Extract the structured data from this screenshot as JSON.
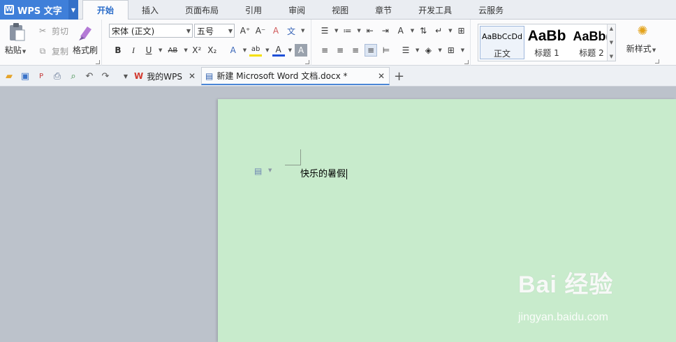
{
  "app": {
    "name": "WPS 文字"
  },
  "menu": {
    "tabs": [
      "开始",
      "插入",
      "页面布局",
      "引用",
      "审阅",
      "视图",
      "章节",
      "开发工具",
      "云服务"
    ],
    "active_tab": "开始"
  },
  "ribbon": {
    "paste_label": "粘贴",
    "cut_label": "剪切",
    "copy_label": "复制",
    "format_painter_label": "格式刷",
    "font_name": "宋体 (正文)",
    "font_size": "五号",
    "styles": [
      {
        "sample": "AaBbCcDd",
        "name": "正文"
      },
      {
        "sample": "AaBb",
        "name": "标题 1"
      },
      {
        "sample": "AaBb(",
        "name": "标题 2"
      }
    ],
    "new_style_label": "新样式",
    "icons": {
      "increase_font": "A⁺",
      "decrease_font": "A⁻",
      "clear_format": "A",
      "phonetic": "文",
      "bold": "B",
      "italic": "I",
      "underline": "U",
      "strikethrough": "AB",
      "superscript": "X²",
      "subscript": "X₂",
      "text_effect": "A",
      "highlight": "ab",
      "font_color": "A",
      "char_shading": "A"
    }
  },
  "doc_tabs": [
    {
      "title": "我的WPS"
    },
    {
      "title": "新建 Microsoft Word 文档.docx *"
    }
  ],
  "document": {
    "text": "快乐的暑假"
  },
  "watermark": {
    "brand": "Bai 经验",
    "url": "jingyan.baidu.com"
  },
  "colors": {
    "accent": "#3f7fd9",
    "page_bg": "#c8ebcc",
    "workspace_bg": "#bcc2cb",
    "font_color_bar": "#1e4fd8",
    "highlight_bar": "#f5e000"
  }
}
